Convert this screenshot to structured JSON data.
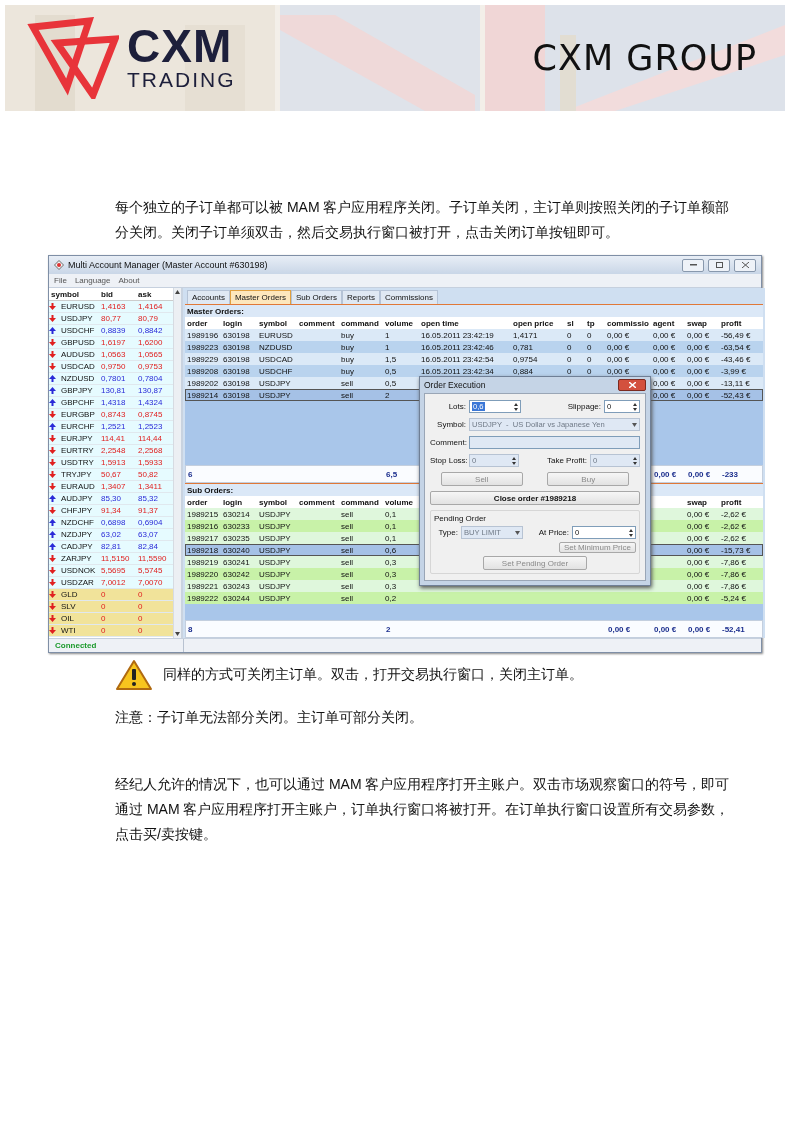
{
  "header": {
    "logo": {
      "name": "CXM",
      "tagline": "TRADING"
    },
    "company": "CXM GROUP"
  },
  "intro": "每个独立的子订单都可以被 MAM 客户应用程序关闭。子订单关闭，主订单则按照关闭的子订单额部分关闭。关闭子订单须双击，然后交易执行窗口被打开，点击关闭订单按钮即可。",
  "app": {
    "window": {
      "title": "Multi Account Manager (Master Account #630198)"
    },
    "menu": [
      {
        "label": "File"
      },
      {
        "label": "Language"
      },
      {
        "label": "About"
      }
    ],
    "market_watch": {
      "columns": [
        "symbol",
        "bid",
        "ask"
      ],
      "rows": [
        {
          "symbol": "EURUSD",
          "bid": "1,4163",
          "ask": "1,4164",
          "rising": false,
          "kind": "currency"
        },
        {
          "symbol": "USDJPY",
          "bid": "80,77",
          "ask": "80,79",
          "rising": false,
          "kind": "currency"
        },
        {
          "symbol": "USDCHF",
          "bid": "0,8839",
          "ask": "0,8842",
          "rising": true,
          "kind": "currency"
        },
        {
          "symbol": "GBPUSD",
          "bid": "1,6197",
          "ask": "1,6200",
          "rising": false,
          "kind": "currency"
        },
        {
          "symbol": "AUDUSD",
          "bid": "1,0563",
          "ask": "1,0565",
          "rising": false,
          "kind": "currency"
        },
        {
          "symbol": "USDCAD",
          "bid": "0,9750",
          "ask": "0,9753",
          "rising": false,
          "kind": "currency"
        },
        {
          "symbol": "NZDUSD",
          "bid": "0,7801",
          "ask": "0,7804",
          "rising": true,
          "kind": "currency"
        },
        {
          "symbol": "GBPJPY",
          "bid": "130,81",
          "ask": "130,87",
          "rising": true,
          "kind": "currency"
        },
        {
          "symbol": "GBPCHF",
          "bid": "1,4318",
          "ask": "1,4324",
          "rising": true,
          "kind": "currency"
        },
        {
          "symbol": "EURGBP",
          "bid": "0,8743",
          "ask": "0,8745",
          "rising": false,
          "kind": "currency"
        },
        {
          "symbol": "EURCHF",
          "bid": "1,2521",
          "ask": "1,2523",
          "rising": true,
          "kind": "currency"
        },
        {
          "symbol": "EURJPY",
          "bid": "114,41",
          "ask": "114,44",
          "rising": false,
          "kind": "currency"
        },
        {
          "symbol": "EURTRY",
          "bid": "2,2548",
          "ask": "2,2568",
          "rising": false,
          "kind": "currency"
        },
        {
          "symbol": "USDTRY",
          "bid": "1,5913",
          "ask": "1,5933",
          "rising": false,
          "kind": "currency"
        },
        {
          "symbol": "TRYJPY",
          "bid": "50,67",
          "ask": "50,82",
          "rising": false,
          "kind": "currency"
        },
        {
          "symbol": "EURAUD",
          "bid": "1,3407",
          "ask": "1,3411",
          "rising": false,
          "kind": "currency"
        },
        {
          "symbol": "AUDJPY",
          "bid": "85,30",
          "ask": "85,32",
          "rising": true,
          "kind": "currency"
        },
        {
          "symbol": "CHFJPY",
          "bid": "91,34",
          "ask": "91,37",
          "rising": false,
          "kind": "currency"
        },
        {
          "symbol": "NZDCHF",
          "bid": "0,6898",
          "ask": "0,6904",
          "rising": true,
          "kind": "currency"
        },
        {
          "symbol": "NZDJPY",
          "bid": "63,02",
          "ask": "63,07",
          "rising": true,
          "kind": "currency"
        },
        {
          "symbol": "CADJPY",
          "bid": "82,81",
          "ask": "82,84",
          "rising": true,
          "kind": "currency"
        },
        {
          "symbol": "ZARJPY",
          "bid": "11,5150",
          "ask": "11,5590",
          "rising": false,
          "kind": "currency"
        },
        {
          "symbol": "USDNOK",
          "bid": "5,5695",
          "ask": "5,5745",
          "rising": false,
          "kind": "currency"
        },
        {
          "symbol": "USDZAR",
          "bid": "7,0012",
          "ask": "7,0070",
          "rising": false,
          "kind": "currency"
        },
        {
          "symbol": "GLD",
          "bid": "0",
          "ask": "0",
          "rising": false,
          "kind": "commodity"
        },
        {
          "symbol": "SLV",
          "bid": "0",
          "ask": "0",
          "rising": false,
          "kind": "commodity"
        },
        {
          "symbol": "OIL",
          "bid": "0",
          "ask": "0",
          "rising": false,
          "kind": "commodity"
        },
        {
          "symbol": "WTI",
          "bid": "0",
          "ask": "0",
          "rising": false,
          "kind": "commodity"
        }
      ]
    },
    "tabs": [
      {
        "label": "Accounts",
        "selected": false
      },
      {
        "label": "Master Orders",
        "selected": true
      },
      {
        "label": "Sub Orders",
        "selected": false
      },
      {
        "label": "Reports",
        "selected": false
      },
      {
        "label": "Commissions",
        "selected": false
      }
    ],
    "master_orders": {
      "title": "Master Orders:",
      "columns": {
        "order": "order",
        "login": "login",
        "symbol": "symbol",
        "comment": "comment",
        "command": "command",
        "volume": "volume",
        "open_time": "open time",
        "open_price": "open price",
        "sl": "sl",
        "tp": "tp",
        "commission": "commissio",
        "agent": "agent",
        "swap": "swap",
        "profit": "profit"
      },
      "rows": [
        {
          "order": "1989196",
          "login": "630198",
          "symbol": "EURUSD",
          "command": "buy",
          "volume": "1",
          "open_time": "16.05.2011 23:42:19",
          "open_price": "1,4171",
          "sl": "0",
          "tp": "0",
          "commission": "0,00 €",
          "agent": "0,00 €",
          "swap": "0,00 €",
          "profit": "-56,49 €",
          "selected": false
        },
        {
          "order": "1989223",
          "login": "630198",
          "symbol": "NZDUSD",
          "command": "buy",
          "volume": "1",
          "open_time": "16.05.2011 23:42:46",
          "open_price": "0,781",
          "sl": "0",
          "tp": "0",
          "commission": "0,00 €",
          "agent": "0,00 €",
          "swap": "0,00 €",
          "profit": "-63,54 €",
          "selected": false
        },
        {
          "order": "1989229",
          "login": "630198",
          "symbol": "USDCAD",
          "command": "buy",
          "volume": "1,5",
          "open_time": "16.05.2011 23:42:54",
          "open_price": "0,9754",
          "sl": "0",
          "tp": "0",
          "commission": "0,00 €",
          "agent": "0,00 €",
          "swap": "0,00 €",
          "profit": "-43,46 €",
          "selected": false
        },
        {
          "order": "1989208",
          "login": "630198",
          "symbol": "USDCHF",
          "command": "buy",
          "volume": "0,5",
          "open_time": "16.05.2011 23:42:34",
          "open_price": "0,884",
          "sl": "0",
          "tp": "0",
          "commission": "0,00 €",
          "agent": "0,00 €",
          "swap": "0,00 €",
          "profit": "-3,99 €",
          "selected": false
        },
        {
          "order": "1989202",
          "login": "630198",
          "symbol": "USDJPY",
          "command": "sell",
          "volume": "0,5",
          "agent": "0,00 €",
          "swap": "0,00 €",
          "profit": "-13,11 €",
          "selected": false
        },
        {
          "order": "1989214",
          "login": "630198",
          "symbol": "USDJPY",
          "command": "sell",
          "volume": "2",
          "agent": "0,00 €",
          "swap": "0,00 €",
          "profit": "-52,43 €",
          "selected": true
        }
      ],
      "totals": {
        "order": "6",
        "volume": "6,5",
        "agent": "0,00 €",
        "swap": "0,00 €",
        "profit": "-233"
      }
    },
    "sub_orders": {
      "title": "Sub Orders:",
      "columns": {
        "order": "order",
        "login": "login",
        "symbol": "symbol",
        "comment": "comment",
        "command": "command",
        "volume": "volume",
        "swap": "swap",
        "profit": "profit"
      },
      "rows": [
        {
          "order": "1989215",
          "login": "630214",
          "symbol": "USDJPY",
          "command": "sell",
          "volume": "0,1",
          "swap": "0,00 €",
          "profit": "-2,62 €",
          "selected": false
        },
        {
          "order": "1989216",
          "login": "630233",
          "symbol": "USDJPY",
          "command": "sell",
          "volume": "0,1",
          "swap": "0,00 €",
          "profit": "-2,62 €",
          "selected": false
        },
        {
          "order": "1989217",
          "login": "630235",
          "symbol": "USDJPY",
          "command": "sell",
          "volume": "0,1",
          "swap": "0,00 €",
          "profit": "-2,62 €",
          "selected": false
        },
        {
          "order": "1989218",
          "login": "630240",
          "symbol": "USDJPY",
          "command": "sell",
          "volume": "0,6",
          "swap": "0,00 €",
          "profit": "-15,73 €",
          "selected": true
        },
        {
          "order": "1989219",
          "login": "630241",
          "symbol": "USDJPY",
          "command": "sell",
          "volume": "0,3",
          "swap": "0,00 €",
          "profit": "-7,86 €",
          "selected": false
        },
        {
          "order": "1989220",
          "login": "630242",
          "symbol": "USDJPY",
          "command": "sell",
          "volume": "0,3",
          "swap": "0,00 €",
          "profit": "-7,86 €",
          "selected": false
        },
        {
          "order": "1989221",
          "login": "630243",
          "symbol": "USDJPY",
          "command": "sell",
          "volume": "0,3",
          "swap": "0,00 €",
          "profit": "-7,86 €",
          "selected": false
        },
        {
          "order": "1989222",
          "login": "630244",
          "symbol": "USDJPY",
          "command": "sell",
          "volume": "0,2",
          "swap": "0,00 €",
          "profit": "-5,24 €",
          "selected": false
        }
      ],
      "totals": {
        "order": "8",
        "volume": "2",
        "commission": "0,00 €",
        "agent": "0,00 €",
        "swap": "0,00 €",
        "profit": "-52,41"
      }
    },
    "status": "Connected",
    "dialog": {
      "title": "Order Execution",
      "lots": {
        "label": "Lots:",
        "value": "0,6"
      },
      "slippage": {
        "label": "Slippage:",
        "value": "0"
      },
      "symbol": {
        "label": "Symbol:",
        "value": "USDJPY  -  US Dollar vs Japanese Yen",
        "disabled": true
      },
      "comment": {
        "label": "Comment:"
      },
      "stop_loss": {
        "label": "Stop Loss:",
        "value": "0",
        "disabled": true
      },
      "take_profit": {
        "label": "Take Profit:",
        "value": "0",
        "disabled": true
      },
      "trade_buttons": [
        {
          "label": "Sell",
          "disabled": true
        },
        {
          "label": "Buy",
          "disabled": true
        }
      ],
      "close_button": {
        "label": "Close order #1989218",
        "disabled": false
      },
      "pending": {
        "title": "Pending Order",
        "type": {
          "label": "Type:",
          "value": "BUY LIMIT",
          "disabled": true
        },
        "price": {
          "label": "At Price:",
          "value": "0",
          "disabled": false
        },
        "min_button": {
          "label": "Set Minimum Price",
          "disabled": true
        },
        "set_button": {
          "label": "Set Pending Order",
          "disabled": true
        }
      }
    }
  },
  "warning": "同样的方式可关闭主订单。双击，打开交易执行窗口，关闭主订单。",
  "note": "注意：子订单无法部分关闭。主订单可部分关闭。",
  "paragraph": "经纪人允许的情况下，也可以通过 MAM 客户应用程序打开主账户。双击市场观察窗口的符号，即可通过 MAM 客户应用程序打开主账户，订单执行窗口将被打开。在订单执行窗口设置所有交易参数，点击买/卖按键。"
}
